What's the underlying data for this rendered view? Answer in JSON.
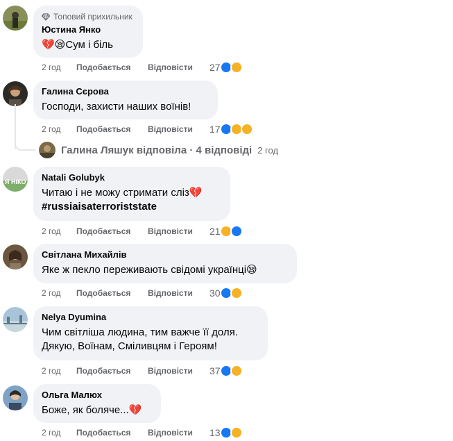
{
  "comments": [
    {
      "badge": "Топовий прихильник",
      "author": "Юстина Янко",
      "lines": [
        "💔😪Сум і біль"
      ],
      "time": "2 год",
      "like": "Подобається",
      "reply": "Відповісти",
      "reactions_count": "27",
      "reaction_icons": [
        "like-reaction-icon",
        "sad-reaction-icon"
      ]
    },
    {
      "author": "Галина Сєрова",
      "lines": [
        "Господи, захисти наших воїнів!"
      ],
      "time": "2 год",
      "like": "Подобається",
      "reply": "Відповісти",
      "reactions_count": "17",
      "reaction_icons": [
        "like-reaction-icon",
        "sad-reaction-icon",
        "care-reaction-icon"
      ]
    },
    {
      "author": "Natali Golubyk",
      "lines": [
        "Читаю і не можу стримати сліз💔",
        "#russiaisaterroriststate"
      ],
      "time": "2 год",
      "like": "Подобається",
      "reply": "Відповісти",
      "reactions_count": "21",
      "reaction_icons": [
        "sad-reaction-icon",
        "like-reaction-icon"
      ]
    },
    {
      "author": "Світлана Михайлів",
      "lines": [
        "Яке ж пекло переживають свідомі українці😪"
      ],
      "time": "2 год",
      "like": "Подобається",
      "reply": "Відповісти",
      "reactions_count": "30",
      "reaction_icons": [
        "like-reaction-icon",
        "sad-reaction-icon"
      ]
    },
    {
      "author": "Nelya Dyumina",
      "lines": [
        "Чим світліша людина, тим важче її доля.",
        "Дякую, Воїнам, Сміливцям і Героям!"
      ],
      "time": "2 год",
      "like": "Подобається",
      "reply": "Відповісти",
      "reactions_count": "37",
      "reaction_icons": [
        "like-reaction-icon",
        "sad-reaction-icon"
      ]
    },
    {
      "author": "Ольга Малюх",
      "lines": [
        "Боже, як боляче...💔"
      ],
      "time": "2 год",
      "like": "Подобається",
      "reply": "Відповісти",
      "reactions_count": "13",
      "reaction_icons": [
        "like-reaction-icon",
        "sad-reaction-icon"
      ]
    }
  ],
  "replies_summary": {
    "text": "Галина Ляшук відповіла · 4 відповіді",
    "time": "2 год"
  },
  "avatar_3_text": "Я НІКО",
  "colors": {
    "bubble": "#f0f2f5",
    "secondary_text": "#65676b",
    "like_blue": "#1877f2",
    "sad_yellow": "#f7b125"
  }
}
